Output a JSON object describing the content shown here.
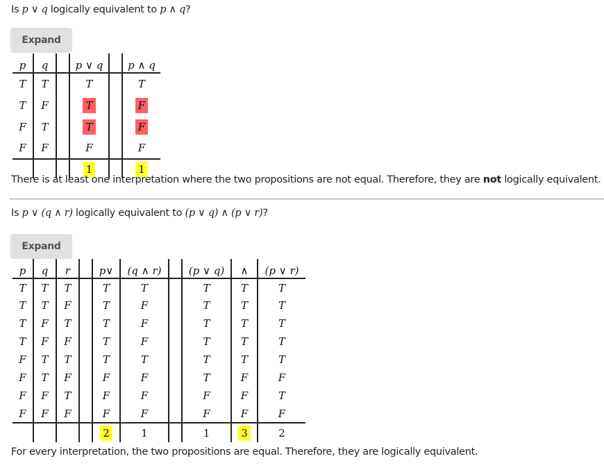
{
  "sections": [
    {
      "question": {
        "prefix": "Is ",
        "lhs": "p ∨ q",
        "middle": " logically equivalent to ",
        "rhs": "p ∧ q",
        "suffix": "?"
      },
      "expand_label": "Expand",
      "table": {
        "headers": [
          "p",
          "q",
          "",
          "p ∨ q",
          "",
          "p ∧ q"
        ],
        "rows": [
          [
            "T",
            "T",
            "",
            "T",
            "",
            "T"
          ],
          [
            "T",
            "F",
            "",
            "T",
            "",
            "F"
          ],
          [
            "F",
            "T",
            "",
            "T",
            "",
            "F"
          ],
          [
            "F",
            "F",
            "",
            "F",
            "",
            "F"
          ]
        ],
        "highlighted_rows": [
          1,
          2
        ],
        "counts": [
          "",
          "",
          "",
          "1",
          "",
          "1"
        ]
      },
      "conclusion": {
        "before": "There is at least one interpretation where the two propositions are not equal. Therefore, they are ",
        "bold": "not",
        "after": " logically equivalent."
      }
    },
    {
      "question": {
        "prefix": "Is ",
        "lhs": "p ∨ (q ∧ r)",
        "middle": " logically equivalent to ",
        "rhs": "(p ∨ q) ∧ (p ∨ r)",
        "suffix": "?"
      },
      "expand_label": "Expand",
      "table": {
        "headers": [
          "p",
          "q",
          "r",
          "",
          "p∨",
          "(q ∧ r)",
          "",
          "(p ∨ q)",
          "∧",
          "(p ∨ r)"
        ],
        "rows": [
          [
            "T",
            "T",
            "T",
            "",
            "T",
            "T",
            "",
            "T",
            "T",
            "T"
          ],
          [
            "T",
            "T",
            "F",
            "",
            "T",
            "F",
            "",
            "T",
            "T",
            "T"
          ],
          [
            "T",
            "F",
            "T",
            "",
            "T",
            "F",
            "",
            "T",
            "T",
            "T"
          ],
          [
            "T",
            "F",
            "F",
            "",
            "T",
            "F",
            "",
            "T",
            "T",
            "T"
          ],
          [
            "F",
            "T",
            "T",
            "",
            "T",
            "T",
            "",
            "T",
            "T",
            "T"
          ],
          [
            "F",
            "T",
            "F",
            "",
            "F",
            "F",
            "",
            "T",
            "F",
            "F"
          ],
          [
            "F",
            "F",
            "T",
            "",
            "F",
            "F",
            "",
            "F",
            "F",
            "T"
          ],
          [
            "F",
            "F",
            "F",
            "",
            "F",
            "F",
            "",
            "F",
            "F",
            "F"
          ]
        ],
        "counts": [
          "",
          "",
          "",
          "",
          "2",
          "1",
          "",
          "1",
          "3",
          "2"
        ],
        "main_connective_counts": [
          "2",
          "3"
        ]
      },
      "conclusion": {
        "text": "For every interpretation, the two propositions are equal. Therefore, they are logically equivalent."
      }
    }
  ],
  "colors": {
    "mismatch_highlight": "#ff5f61",
    "main_connective_highlight": "#ffff2a",
    "button_bg": "#e1e1e1"
  }
}
